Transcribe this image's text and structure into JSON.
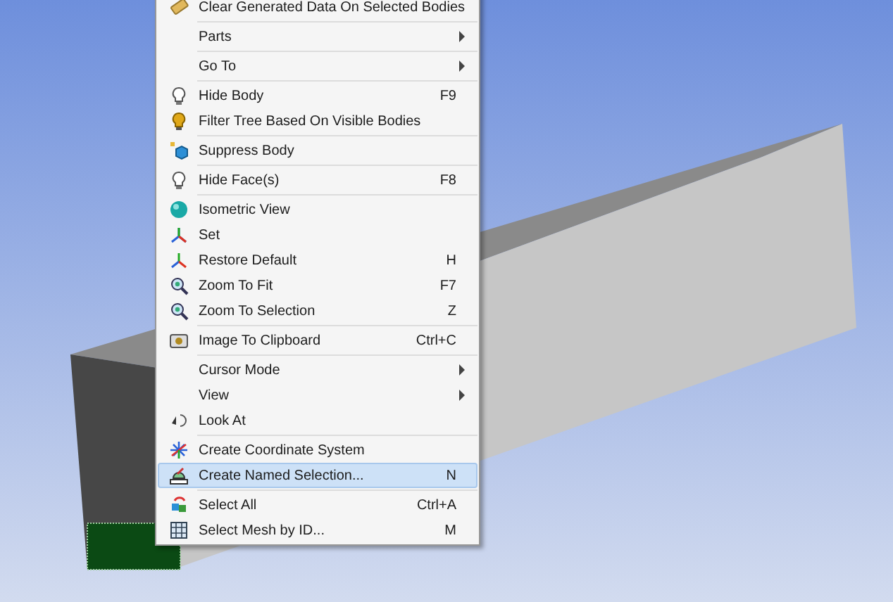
{
  "context_menu": {
    "items": [
      {
        "kind": "item",
        "label": "Clear Generated Data On Selected Bodies",
        "selected": false
      },
      {
        "kind": "separator"
      },
      {
        "kind": "item",
        "label": "Parts",
        "submenu": true,
        "selected": false
      },
      {
        "kind": "separator"
      },
      {
        "kind": "item",
        "label": "Go To",
        "submenu": true,
        "selected": false
      },
      {
        "kind": "separator"
      },
      {
        "kind": "item",
        "label": "Hide Body",
        "shortcut": "F9",
        "selected": false
      },
      {
        "kind": "item",
        "label": "Filter Tree Based On Visible Bodies",
        "selected": false
      },
      {
        "kind": "separator"
      },
      {
        "kind": "item",
        "label": "Suppress Body",
        "selected": false
      },
      {
        "kind": "separator"
      },
      {
        "kind": "item",
        "label": "Hide Face(s)",
        "shortcut": "F8",
        "selected": false
      },
      {
        "kind": "separator"
      },
      {
        "kind": "item",
        "label": "Isometric View",
        "selected": false
      },
      {
        "kind": "item",
        "label": "Set",
        "selected": false
      },
      {
        "kind": "item",
        "label": "Restore Default",
        "shortcut": "H",
        "selected": false
      },
      {
        "kind": "item",
        "label": "Zoom To Fit",
        "shortcut": "F7",
        "selected": false
      },
      {
        "kind": "item",
        "label": "Zoom To Selection",
        "shortcut": "Z",
        "selected": false
      },
      {
        "kind": "separator"
      },
      {
        "kind": "item",
        "label": "Image To Clipboard",
        "shortcut": "Ctrl+C",
        "selected": false
      },
      {
        "kind": "separator"
      },
      {
        "kind": "item",
        "label": "Cursor Mode",
        "submenu": true,
        "selected": false
      },
      {
        "kind": "item",
        "label": "View",
        "submenu": true,
        "selected": false
      },
      {
        "kind": "item",
        "label": "Look At",
        "selected": false
      },
      {
        "kind": "separator"
      },
      {
        "kind": "item",
        "label": "Create Coordinate System",
        "selected": false
      },
      {
        "kind": "item",
        "label": "Create Named Selection...",
        "shortcut": "N",
        "selected": true
      },
      {
        "kind": "separator"
      },
      {
        "kind": "item",
        "label": "Select All",
        "shortcut": "Ctrl+A",
        "selected": false
      },
      {
        "kind": "item",
        "label": "Select Mesh by ID...",
        "shortcut": "M",
        "selected": false
      }
    ]
  }
}
